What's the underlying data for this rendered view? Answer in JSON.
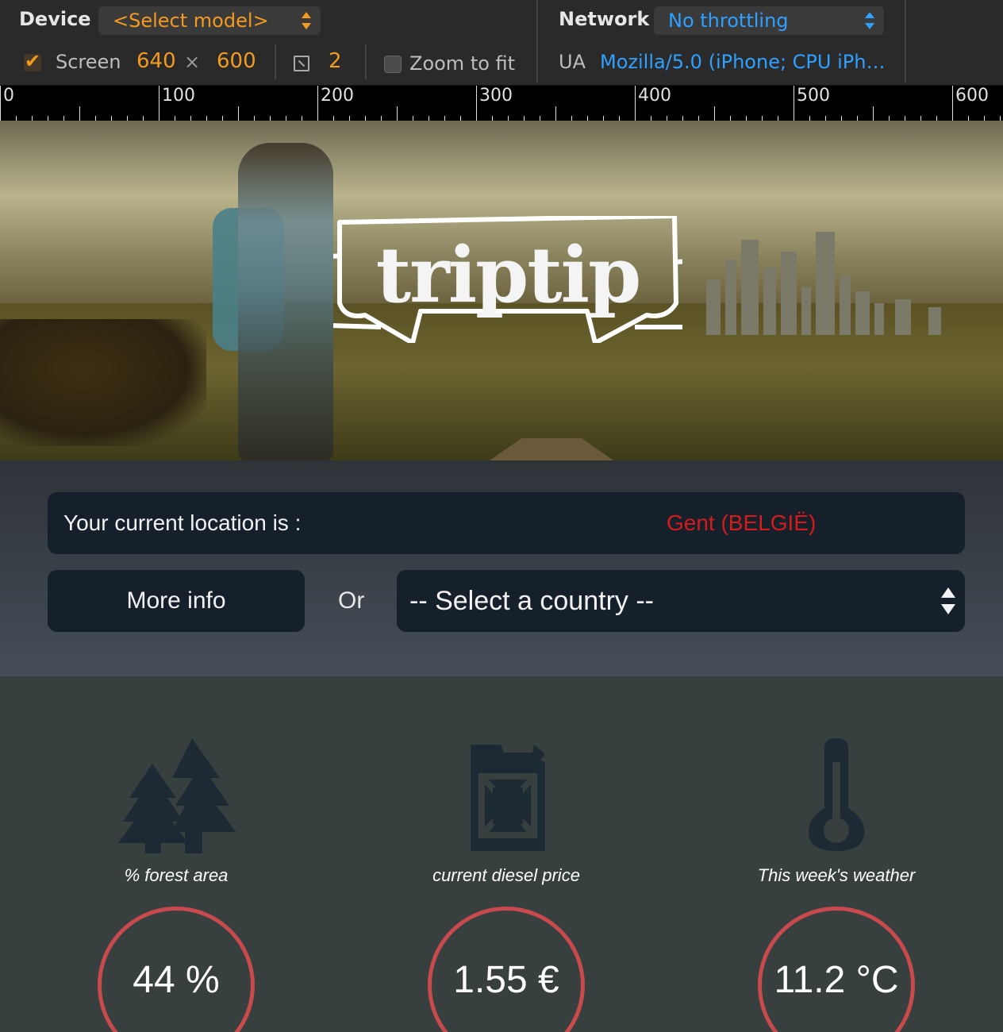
{
  "devtools": {
    "device_label": "Device",
    "device_select": "<Select model>",
    "network_label": "Network",
    "network_select": "No throttling",
    "screen_label": "Screen",
    "screen_width": "640",
    "times": "×",
    "screen_height": "600",
    "dpr": "2",
    "zoom_label": "Zoom to fit",
    "ua_label": "UA",
    "ua_value": "Mozilla/5.0 (iPhone; CPU iPh…"
  },
  "ruler": {
    "labels": [
      "0",
      "100",
      "200",
      "300",
      "400",
      "500",
      "600"
    ]
  },
  "hero": {
    "logo_text": "triptip"
  },
  "location": {
    "label": "Your current location is :",
    "value": "Gent (BELGIË)",
    "more_info": "More info",
    "or": "Or",
    "country_placeholder": "-- Select a country --"
  },
  "stats": [
    {
      "icon": "trees-icon",
      "caption": "% forest area",
      "value": "44 %"
    },
    {
      "icon": "jerrycan-icon",
      "caption": "current diesel price",
      "value": "1.55 €"
    },
    {
      "icon": "thermometer-icon",
      "caption": "This week's weather",
      "value": "11.2 °C"
    }
  ],
  "colors": {
    "accent_orange": "#f39a1f",
    "accent_blue": "#2ea0ff",
    "location_red": "#d41c1c",
    "ring_red": "#c84a4d",
    "icon_dark": "#1d2a33"
  }
}
